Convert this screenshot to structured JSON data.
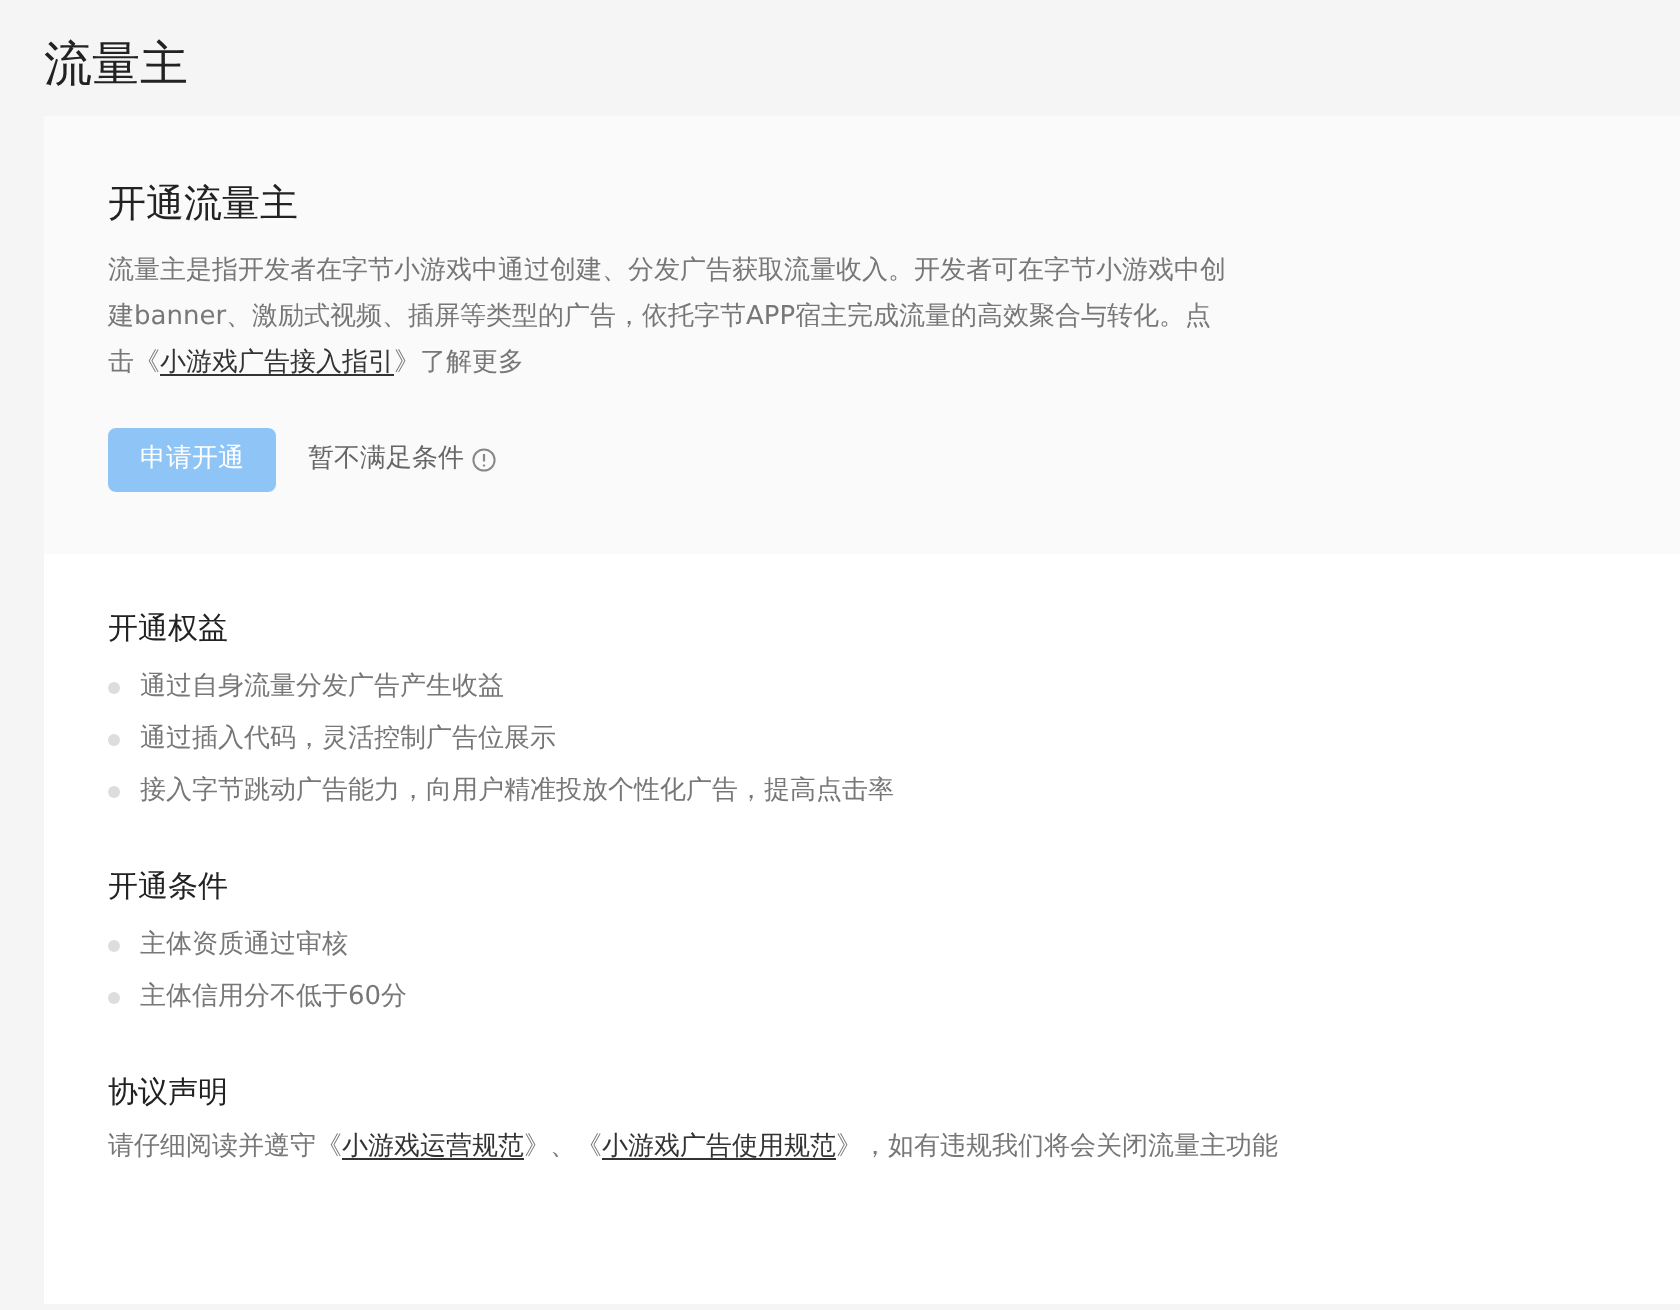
{
  "page_title": "流量主",
  "intro": {
    "title": "开通流量主",
    "paragraph": [
      {
        "kind": "text",
        "text": "流量主是指开发者在字节小游戏中通过创建、分发广告获取流量收入。开发者可在字节小游戏中创建banner、激励式视频、插屏等类型的广告，依托字节APP宿主完成流量的高效聚合与转化。点击《"
      },
      {
        "kind": "link",
        "text": "小游戏广告接入指引"
      },
      {
        "kind": "text",
        "text": "》了解更多"
      }
    ],
    "apply_button": {
      "label": "申请开通",
      "disabled": true
    },
    "condition_note": "暂不满足条件"
  },
  "sections": [
    {
      "title": "开通权益",
      "items": [
        "通过自身流量分发广告产生收益",
        "通过插入代码，灵活控制广告位展示",
        "接入字节跳动广告能力，向用户精准投放个性化广告，提高点击率"
      ]
    },
    {
      "title": "开通条件",
      "items": [
        "主体资质通过审核",
        "主体信用分不低于60分"
      ]
    },
    {
      "title": "协议声明",
      "paragraph": [
        {
          "kind": "text",
          "text": "请仔细阅读并遵守《"
        },
        {
          "kind": "link",
          "text": "小游戏运营规范"
        },
        {
          "kind": "text",
          "text": "》、《"
        },
        {
          "kind": "link",
          "text": "小游戏广告使用规范"
        },
        {
          "kind": "text",
          "text": "》，如有违规我们将会关闭流量主功能"
        }
      ]
    }
  ]
}
